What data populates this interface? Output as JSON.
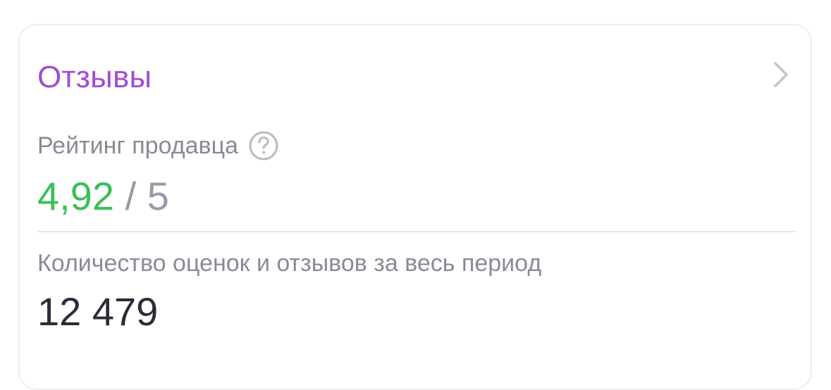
{
  "reviews_card": {
    "title": "Отзывы",
    "chevron_icon": "chevron-right-icon",
    "rating": {
      "label": "Рейтинг продавца",
      "help_icon": "question-circle-icon",
      "score": "4,92",
      "separator": "/",
      "max": "5",
      "score_color": "#3bbf57"
    },
    "count": {
      "label": "Количество оценок и отзывов за весь период",
      "value": "12 479"
    }
  },
  "colors": {
    "accent": "#a14bd3",
    "muted_text": "#8a8a96",
    "primary_text": "#2d2b38"
  }
}
